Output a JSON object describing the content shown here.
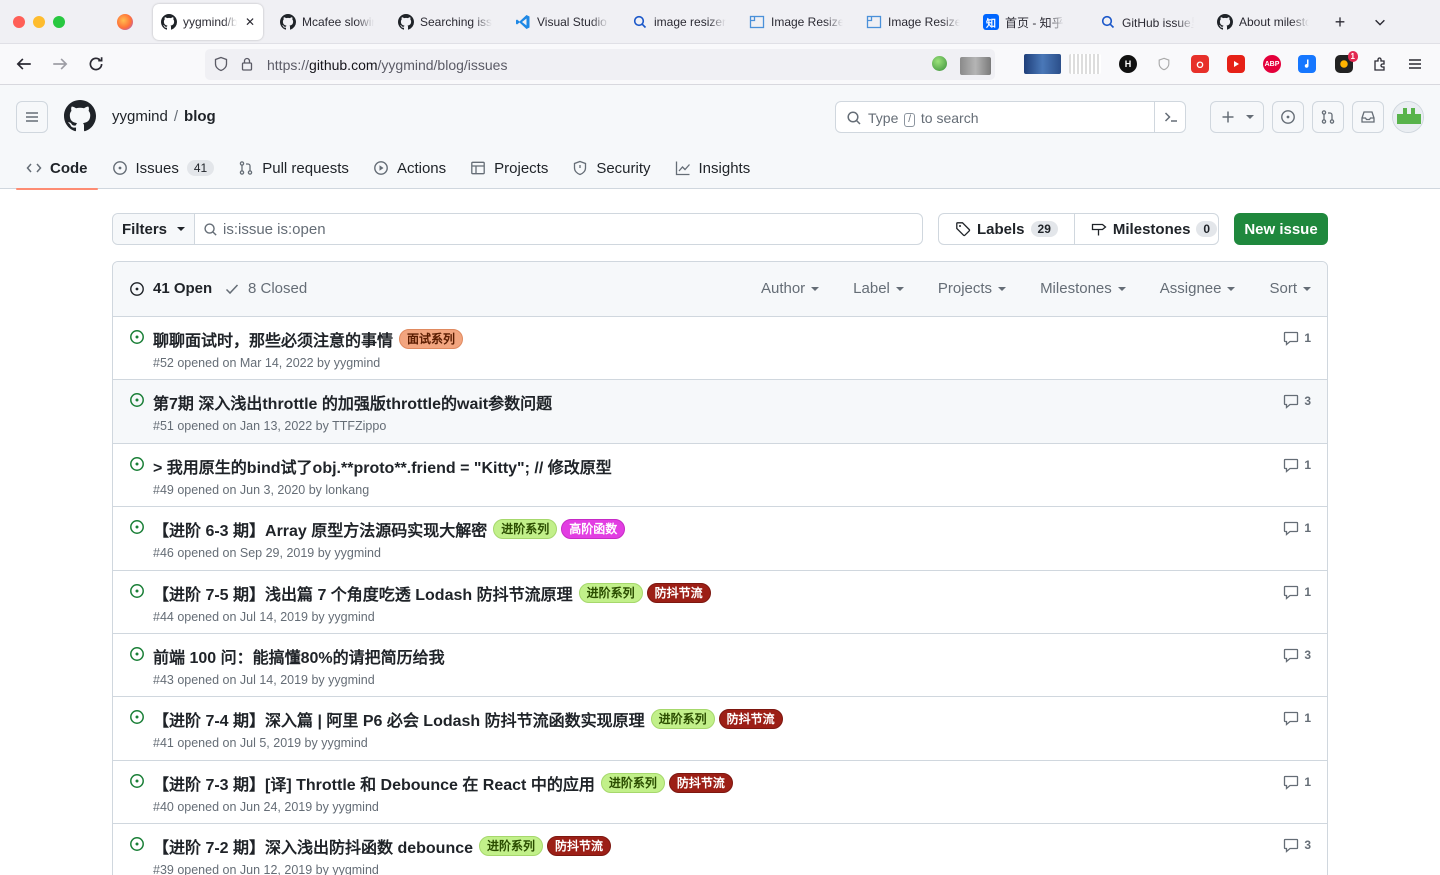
{
  "browser": {
    "tabs": [
      {
        "label": "yygmind/blog",
        "icon": "github-icon",
        "active": true
      },
      {
        "label": "Mcafee slowing",
        "icon": "github-icon"
      },
      {
        "label": "Searching issues",
        "icon": "github-icon"
      },
      {
        "label": "Visual Studio Code",
        "icon": "vscode-icon"
      },
      {
        "label": "image resizer",
        "icon": "search-icon"
      },
      {
        "label": "Image Resizer",
        "icon": "image-icon"
      },
      {
        "label": "Image Resizer",
        "icon": "image-icon"
      },
      {
        "label": "首页 - 知乎",
        "icon": "zhihu-icon",
        "glyph": "知"
      },
      {
        "label": "GitHub issue里",
        "icon": "search-icon"
      },
      {
        "label": "About milestones",
        "icon": "github-icon"
      }
    ],
    "url_scheme": "https://",
    "url_host": "github.com",
    "url_path": "/yygmind/blog/issues",
    "ext_badge": "1",
    "ext_abp": "ABP",
    "ext_h": "H"
  },
  "github": {
    "owner": "yygmind",
    "separator": "/",
    "repo": "blog",
    "search": {
      "prefix": "Type",
      "key": "/",
      "suffix": "to search"
    },
    "repo_tabs": [
      {
        "label": "Code",
        "icon": "code-icon",
        "selected": true
      },
      {
        "label": "Issues",
        "icon": "issue-opened-icon",
        "count": "41"
      },
      {
        "label": "Pull requests",
        "icon": "git-pull-request-icon"
      },
      {
        "label": "Actions",
        "icon": "play-icon"
      },
      {
        "label": "Projects",
        "icon": "table-icon"
      },
      {
        "label": "Security",
        "icon": "shield-icon"
      },
      {
        "label": "Insights",
        "icon": "graph-icon"
      }
    ]
  },
  "subnav": {
    "filters_label": "Filters",
    "query": "is:issue is:open",
    "labels_label": "Labels",
    "labels_count": "29",
    "milestones_label": "Milestones",
    "milestones_count": "0",
    "new_issue_label": "New issue"
  },
  "issues_header": {
    "open_label": "41 Open",
    "closed_label": "8 Closed",
    "menus": [
      "Author",
      "Label",
      "Projects",
      "Milestones",
      "Assignee",
      "Sort"
    ]
  },
  "colors": {
    "open_green": "#1a7f37",
    "primary_button": "#1f883d",
    "selected_tab_underline": "#fd8c73"
  },
  "issues": [
    {
      "title": "聊聊面试时，那些必须注意的事情",
      "meta": "#52 opened on Mar 14, 2022 by yygmind",
      "comments": "1",
      "hover": false,
      "labels": [
        {
          "name": "面试系列",
          "bg": "#f2a57f",
          "fg": "#5a1c00",
          "border": "#e08a60"
        }
      ]
    },
    {
      "title": "第7期 深入浅出throttle 的加强版throttle的wait参数问题",
      "meta": "#51 opened on Jan 13, 2022 by TTFZippo",
      "comments": "3",
      "hover": true,
      "labels": []
    },
    {
      "title": "> 我用原生的bind试了obj.**proto**.friend = \"Kitty\"; // 修改原型",
      "meta": "#49 opened on Jun 3, 2020 by lonkang",
      "comments": "1",
      "hover": false,
      "labels": []
    },
    {
      "title": "【进阶 6-3 期】Array 原型方法源码实现大解密",
      "meta": "#46 opened on Sep 29, 2019 by yygmind",
      "comments": "1",
      "hover": false,
      "labels": [
        {
          "name": "进阶系列",
          "bg": "#c2f08a",
          "fg": "#2b4d00",
          "border": "#a6d86c"
        },
        {
          "name": "高阶函数",
          "bg": "#e23ee2",
          "fg": "#ffffff",
          "border": "#c62ac6"
        }
      ]
    },
    {
      "title": "【进阶 7-5 期】浅出篇 7 个角度吃透 Lodash 防抖节流原理",
      "meta": "#44 opened on Jul 14, 2019 by yygmind",
      "comments": "1",
      "hover": false,
      "labels": [
        {
          "name": "进阶系列",
          "bg": "#c2f08a",
          "fg": "#2b4d00",
          "border": "#a6d86c"
        },
        {
          "name": "防抖节流",
          "bg": "#9c1f16",
          "fg": "#ffffff",
          "border": "#7d1710"
        }
      ]
    },
    {
      "title": "前端 100 问：能搞懂80%的请把简历给我",
      "meta": "#43 opened on Jul 14, 2019 by yygmind",
      "comments": "3",
      "hover": false,
      "labels": []
    },
    {
      "title": "【进阶 7-4 期】深入篇 | 阿里 P6 必会 Lodash 防抖节流函数实现原理",
      "meta": "#41 opened on Jul 5, 2019 by yygmind",
      "comments": "1",
      "hover": false,
      "labels": [
        {
          "name": "进阶系列",
          "bg": "#c2f08a",
          "fg": "#2b4d00",
          "border": "#a6d86c"
        },
        {
          "name": "防抖节流",
          "bg": "#9c1f16",
          "fg": "#ffffff",
          "border": "#7d1710"
        }
      ]
    },
    {
      "title": "【进阶 7-3 期】[译] Throttle 和 Debounce 在 React 中的应用",
      "meta": "#40 opened on Jun 24, 2019 by yygmind",
      "comments": "1",
      "hover": false,
      "labels": [
        {
          "name": "进阶系列",
          "bg": "#c2f08a",
          "fg": "#2b4d00",
          "border": "#a6d86c"
        },
        {
          "name": "防抖节流",
          "bg": "#9c1f16",
          "fg": "#ffffff",
          "border": "#7d1710"
        }
      ]
    },
    {
      "title": "【进阶 7-2 期】深入浅出防抖函数 debounce",
      "meta": "#39 opened on Jun 12, 2019 by yygmind",
      "comments": "3",
      "hover": false,
      "labels": [
        {
          "name": "进阶系列",
          "bg": "#c2f08a",
          "fg": "#2b4d00",
          "border": "#a6d86c"
        },
        {
          "name": "防抖节流",
          "bg": "#9c1f16",
          "fg": "#ffffff",
          "border": "#7d1710"
        }
      ]
    }
  ]
}
